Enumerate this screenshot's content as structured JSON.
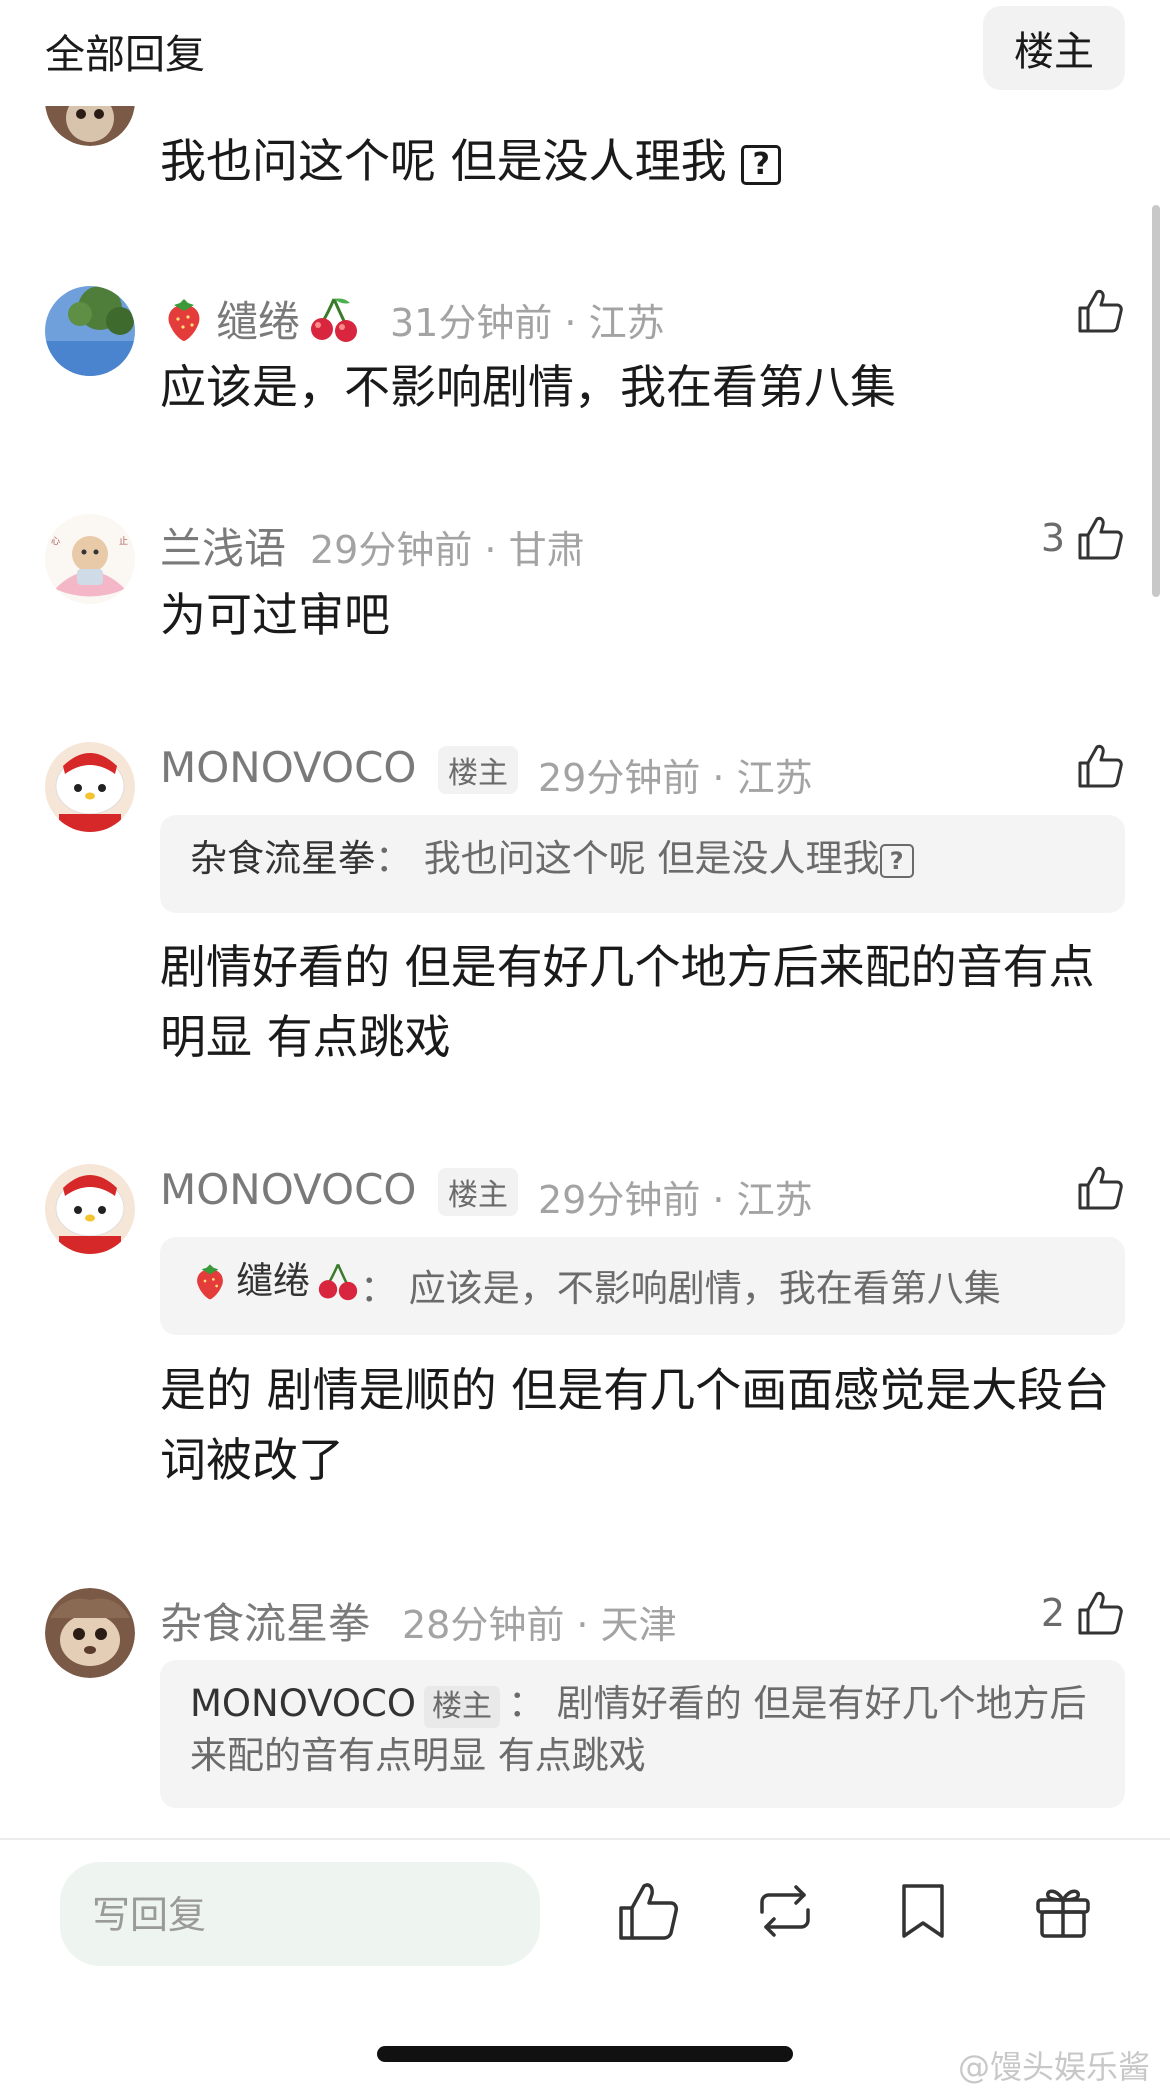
{
  "header": {
    "title": "全部回复",
    "op_filter": "楼主"
  },
  "comments": [
    {
      "text": "我也问这个呢 但是没人理我"
    },
    {
      "name": "缱绻",
      "meta": "31分钟前 · 江苏",
      "text": "应该是，不影响剧情，我在看第八集"
    },
    {
      "name": "兰浅语",
      "meta": "29分钟前 · 甘肃",
      "likes": "3",
      "text": "为可过审吧"
    },
    {
      "name": "MONOVOCO",
      "op_tag": "楼主",
      "meta": "29分钟前 · 江苏",
      "quote_name": "杂食流星拳",
      "quote_sep": "：",
      "quote_text": "我也问这个呢 但是没人理我",
      "text": "剧情好看的 但是有好几个地方后来配的音有点明显 有点跳戏"
    },
    {
      "name": "MONOVOCO",
      "op_tag": "楼主",
      "meta": "29分钟前 · 江苏",
      "quote_name": "缱绻",
      "quote_sep": "：",
      "quote_text": "应该是，不影响剧情，我在看第八集",
      "text": "是的 剧情是顺的 但是有几个画面感觉是大段台词被改了"
    },
    {
      "name": "杂食流星拳",
      "meta": "28分钟前 · 天津",
      "likes": "2",
      "quote_name": "MONOVOCO",
      "quote_tag": "楼主",
      "quote_sep": "：",
      "quote_text": "剧情好看的 但是有好几个地方后来配的音有点明显 有点跳戏"
    }
  ],
  "bottom_bar": {
    "placeholder": "写回复",
    "icons": [
      "like-icon",
      "repost-icon",
      "bookmark-icon",
      "gift-icon"
    ]
  },
  "watermark": "@馒头娱乐酱",
  "colors": {
    "meta": "#a3a3a3",
    "reply_box": "#eef5f0",
    "quote_bg": "#f4f4f4"
  }
}
